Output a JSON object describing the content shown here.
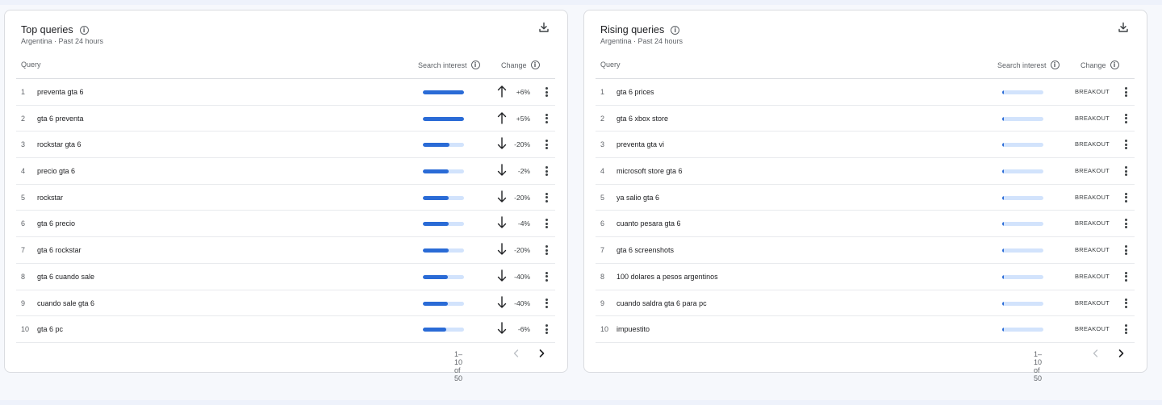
{
  "colors": {
    "accent": "#2a6bd6",
    "track": "#d2e3fc",
    "text_secondary": "#5f6368",
    "border": "#dadce0"
  },
  "icons": {
    "info": "i",
    "download": "download-icon",
    "arrow_up": "arrow-up-icon",
    "arrow_down": "arrow-down-icon",
    "more": "more-vert-icon",
    "prev": "chevron-left-icon",
    "next": "chevron-right-icon"
  },
  "top_queries": {
    "title": "Top queries",
    "subtitle": "Argentina · Past 24 hours",
    "columns": {
      "query": "Query",
      "interest": "Search interest",
      "change": "Change"
    },
    "rows": [
      {
        "rank": "1",
        "query": "preventa gta 6",
        "interest": 1.0,
        "direction": "up",
        "change": "+6%"
      },
      {
        "rank": "2",
        "query": "gta 6 preventa",
        "interest": 1.0,
        "direction": "up",
        "change": "+5%"
      },
      {
        "rank": "3",
        "query": "rockstar gta 6",
        "interest": 0.65,
        "direction": "down",
        "change": "-20%"
      },
      {
        "rank": "4",
        "query": "precio gta 6",
        "interest": 0.63,
        "direction": "down",
        "change": "-2%"
      },
      {
        "rank": "5",
        "query": "rockstar",
        "interest": 0.63,
        "direction": "down",
        "change": "-20%"
      },
      {
        "rank": "6",
        "query": "gta 6 precio",
        "interest": 0.63,
        "direction": "down",
        "change": "-4%"
      },
      {
        "rank": "7",
        "query": "gta 6 rockstar",
        "interest": 0.63,
        "direction": "down",
        "change": "-20%"
      },
      {
        "rank": "8",
        "query": "gta 6 cuando sale",
        "interest": 0.61,
        "direction": "down",
        "change": "-40%"
      },
      {
        "rank": "9",
        "query": "cuando sale gta 6",
        "interest": 0.61,
        "direction": "down",
        "change": "-40%"
      },
      {
        "rank": "10",
        "query": "gta 6 pc",
        "interest": 0.57,
        "direction": "down",
        "change": "-6%"
      }
    ],
    "pagination": "1–10 of 50"
  },
  "rising_queries": {
    "title": "Rising queries",
    "subtitle": "Argentina · Past 24 hours",
    "columns": {
      "query": "Query",
      "interest": "Search interest",
      "change": "Change"
    },
    "rows": [
      {
        "rank": "1",
        "query": "gta 6 prices",
        "interest": 0.04,
        "change": "BREAKOUT"
      },
      {
        "rank": "2",
        "query": "gta 6 xbox store",
        "interest": 0.04,
        "change": "BREAKOUT"
      },
      {
        "rank": "3",
        "query": "preventa gta vi",
        "interest": 0.04,
        "change": "BREAKOUT"
      },
      {
        "rank": "4",
        "query": "microsoft store gta 6",
        "interest": 0.03,
        "change": "BREAKOUT"
      },
      {
        "rank": "5",
        "query": "ya salio gta 6",
        "interest": 0.03,
        "change": "BREAKOUT"
      },
      {
        "rank": "6",
        "query": "cuanto pesara gta 6",
        "interest": 0.03,
        "change": "BREAKOUT"
      },
      {
        "rank": "7",
        "query": "gta 6 screenshots",
        "interest": 0.03,
        "change": "BREAKOUT"
      },
      {
        "rank": "8",
        "query": "100 dolares a pesos argentinos",
        "interest": 0.03,
        "change": "BREAKOUT"
      },
      {
        "rank": "9",
        "query": "cuando saldra gta 6 para pc",
        "interest": 0.03,
        "change": "BREAKOUT"
      },
      {
        "rank": "10",
        "query": "impuestito",
        "interest": 0.03,
        "change": "BREAKOUT"
      }
    ],
    "pagination": "1–10 of 50"
  }
}
